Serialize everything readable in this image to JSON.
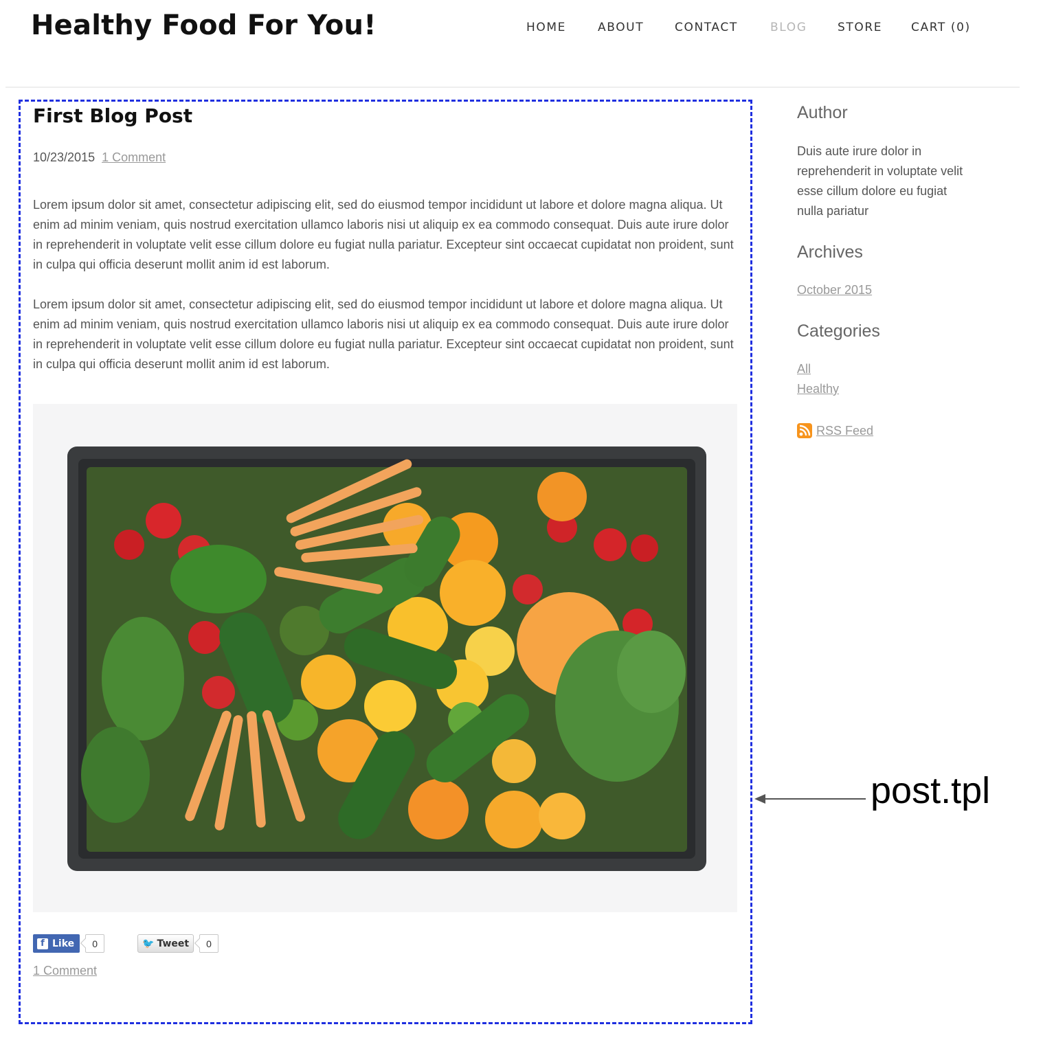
{
  "header": {
    "site_title": "Healthy Food For You!",
    "nav": [
      {
        "label": "HOME"
      },
      {
        "label": "ABOUT"
      },
      {
        "label": "CONTACT"
      },
      {
        "label": "BLOG",
        "active": true
      },
      {
        "label": "STORE"
      },
      {
        "label": "CART (0)"
      }
    ]
  },
  "post": {
    "title": "First Blog Post",
    "date": "10/23/2015",
    "comment_link": "1 Comment",
    "paragraphs": [
      "Lorem ipsum dolor sit amet, consectetur adipiscing elit, sed do eiusmod tempor incididunt ut labore et dolore magna aliqua. Ut enim ad minim veniam, quis nostrud exercitation ullamco laboris nisi ut aliquip ex ea commodo consequat. Duis aute irure dolor in reprehenderit in voluptate velit esse cillum dolore eu fugiat nulla pariatur. Excepteur sint occaecat cupidatat non proident, sunt in culpa qui officia deserunt mollit anim id est laborum.",
      "Lorem ipsum dolor sit amet, consectetur adipiscing elit, sed do eiusmod tempor incididunt ut labore et dolore magna aliqua. Ut enim ad minim veniam, quis nostrud exercitation ullamco laboris nisi ut aliquip ex ea commodo consequat. Duis aute irure dolor in reprehenderit in voluptate velit esse cillum dolore eu fugiat nulla pariatur. Excepteur sint occaecat cupidatat non proident, sunt in culpa qui officia deserunt mollit anim id est laborum."
    ],
    "facebook_like_label": "Like",
    "facebook_like_count": "0",
    "tweet_label": "Tweet",
    "tweet_count": "0",
    "bottom_comment_link": "1 Comment"
  },
  "sidebar": {
    "author_heading": "Author",
    "author_text": "Duis aute irure dolor in reprehenderit in voluptate velit esse cillum dolore eu fugiat nulla pariatur",
    "archives_heading": "Archives",
    "archives": [
      "October 2015"
    ],
    "categories_heading": "Categories",
    "categories": [
      "All",
      "Healthy"
    ],
    "rss_label": "RSS Feed"
  },
  "annotation": {
    "label": "post.tpl",
    "box_color": "#1f2fe0"
  }
}
